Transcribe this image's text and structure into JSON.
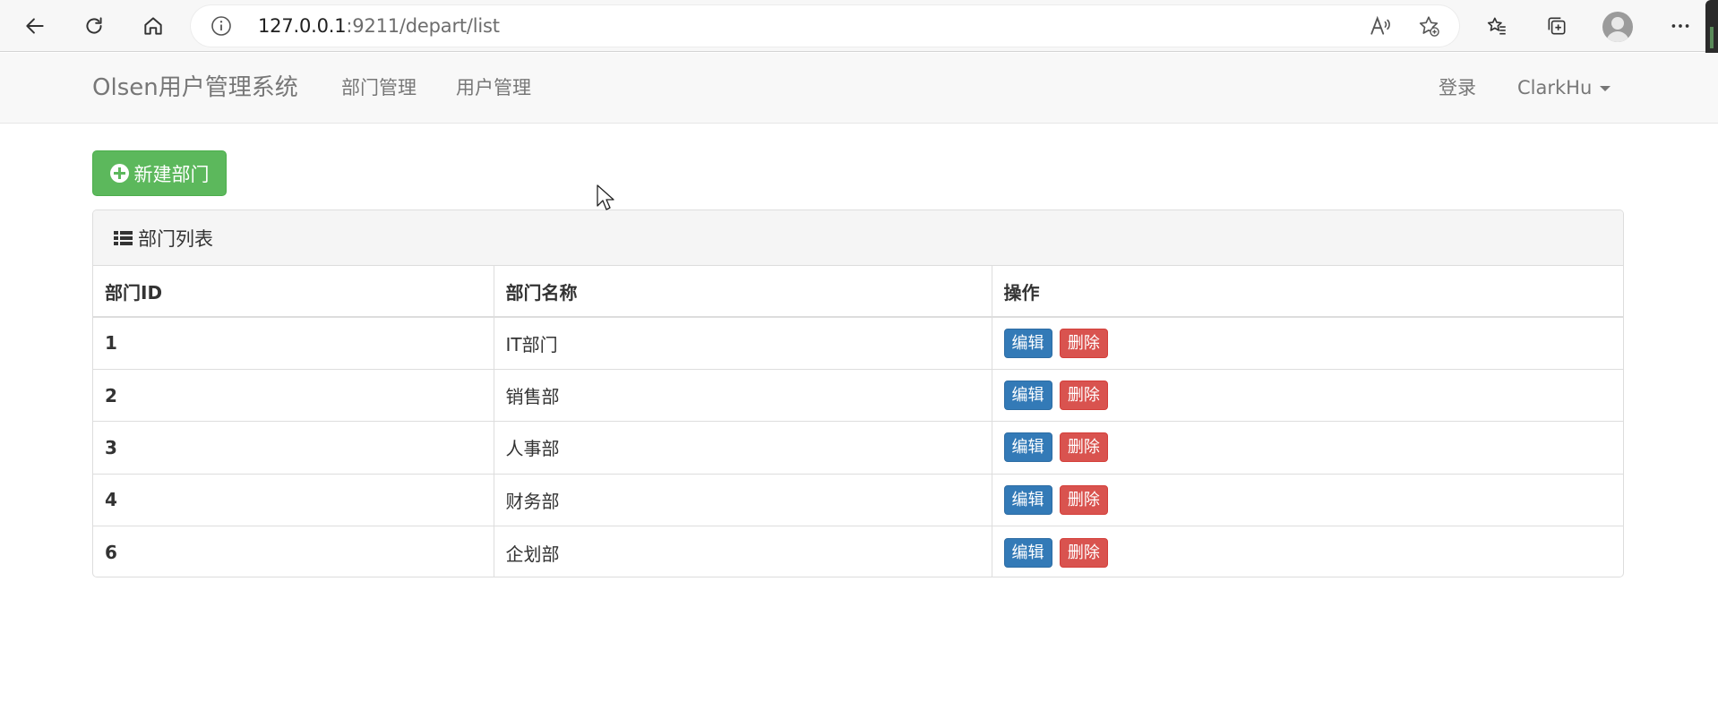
{
  "browser": {
    "url_host": "127.0.0.1",
    "url_rest": ":9211/depart/list"
  },
  "navbar": {
    "brand": "Olsen用户管理系统",
    "links": [
      "部门管理",
      "用户管理"
    ],
    "login": "登录",
    "user": "ClarkHu"
  },
  "toolbar": {
    "new_label": "新建部门"
  },
  "panel": {
    "title": "部门列表",
    "columns": [
      "部门ID",
      "部门名称",
      "操作"
    ],
    "rows": [
      {
        "id": "1",
        "name": "IT部门"
      },
      {
        "id": "2",
        "name": "销售部"
      },
      {
        "id": "3",
        "name": "人事部"
      },
      {
        "id": "4",
        "name": "财务部"
      },
      {
        "id": "6",
        "name": "企划部"
      }
    ],
    "edit_label": "编辑",
    "delete_label": "删除"
  },
  "colors": {
    "success": "#5cb85c",
    "primary": "#337ab7",
    "danger": "#d9534f"
  }
}
